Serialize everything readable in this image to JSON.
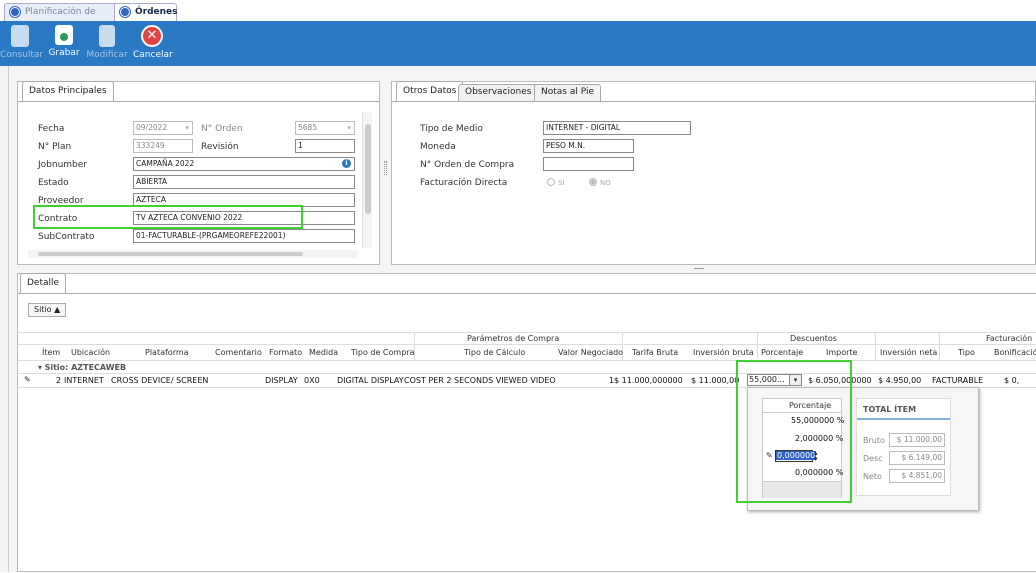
{
  "window_tabs": [
    "Planificación de Digital",
    "Órdenes"
  ],
  "toolbar": {
    "consultar": "Consultar",
    "grabar": "Grabar",
    "modificar": "Modificar",
    "cancelar": "Cancelar"
  },
  "datos_principales": {
    "tab": "Datos Principales",
    "fecha_label": "Fecha",
    "fecha_value": "09/2022",
    "norden_label": "N° Orden",
    "norden_value": "5685",
    "nplan_label": "N° Plan",
    "nplan_value": "333249",
    "revision_label": "Revisión",
    "revision_value": "1",
    "jobnumber_label": "Jobnumber",
    "jobnumber_value": "CAMPAÑA 2022",
    "estado_label": "Estado",
    "estado_value": "ABIERTA",
    "proveedor_label": "Proveedor",
    "proveedor_value": "AZTECA",
    "contrato_label": "Contrato",
    "contrato_value": "TV AZTECA CONVENIO 2022",
    "subcontrato_label": "SubContrato",
    "subcontrato_value": "01-FACTURABLE-(PRGAMEOREFE22001)"
  },
  "otros_datos": {
    "tabs": [
      "Otros Datos",
      "Observaciones",
      "Notas al Pie"
    ],
    "tipo_medio_label": "Tipo de Medio",
    "tipo_medio_value": "INTERNET - DIGITAL",
    "moneda_label": "Moneda",
    "moneda_value": "PESO M.N.",
    "orden_compra_label": "N° Orden de Compra",
    "orden_compra_value": "",
    "facturacion_label": "Facturación Directa",
    "si_label": "SI",
    "no_label": "NO"
  },
  "detalle": {
    "tab": "Detalle",
    "group_button": "Sitio",
    "group_headers": {
      "parametros": "Parámetros de Compra",
      "descuentos": "Descuentos",
      "facturacion": "Facturación"
    },
    "columns": [
      "Ítem",
      "Ubicación",
      "Plataforma",
      "Comentario",
      "Formato",
      "Medida",
      "Tipo de Compra",
      "Tipo de Cálculo",
      "Valor Negociado",
      "Tarifa Bruta",
      "Inversión bruta",
      "Porcentaje",
      "Importe",
      "Inversión neta",
      "Tipo",
      "Bonificación"
    ],
    "group_row": "Sitio: AZTECAWEB",
    "row": {
      "item": "2",
      "ubicacion": "INTERNET",
      "plataforma": "CROSS DEVICE/ SCREEN",
      "comentario": "",
      "formato": "DISPLAY",
      "medida": "0X0",
      "tipo_compra": "DIGITAL DISPLAY",
      "tipo_calculo": "COST PER 2 SECONDS VIEWED VIDEO",
      "valor_negociado": "1",
      "tarifa_bruta": "$ 11.000,000000",
      "inversion_bruta": "$ 11.000,00",
      "porcentaje": "55,000...",
      "importe": "$ 6.050,000000",
      "inversion_neta": "$ 4.950,00",
      "tipo": "FACTURABLE",
      "bonificacion": "$ 0,"
    }
  },
  "popup": {
    "header": "Porcentaje",
    "values": [
      "55,000000 %",
      "2,000000 %",
      "0,000000",
      "0,000000 %"
    ],
    "total_title": "TOTAL ÍTEM",
    "bruto_label": "Bruto",
    "bruto_value": "$ 11.000,00",
    "desc_label": "Desc",
    "desc_value": "$ 6.149,00",
    "neto_label": "Neto",
    "neto_value": "$ 4.851,00"
  },
  "colors": {
    "toolbar": "#2a79c5",
    "highlight": "#3ed12f",
    "cancel": "#e04343"
  }
}
